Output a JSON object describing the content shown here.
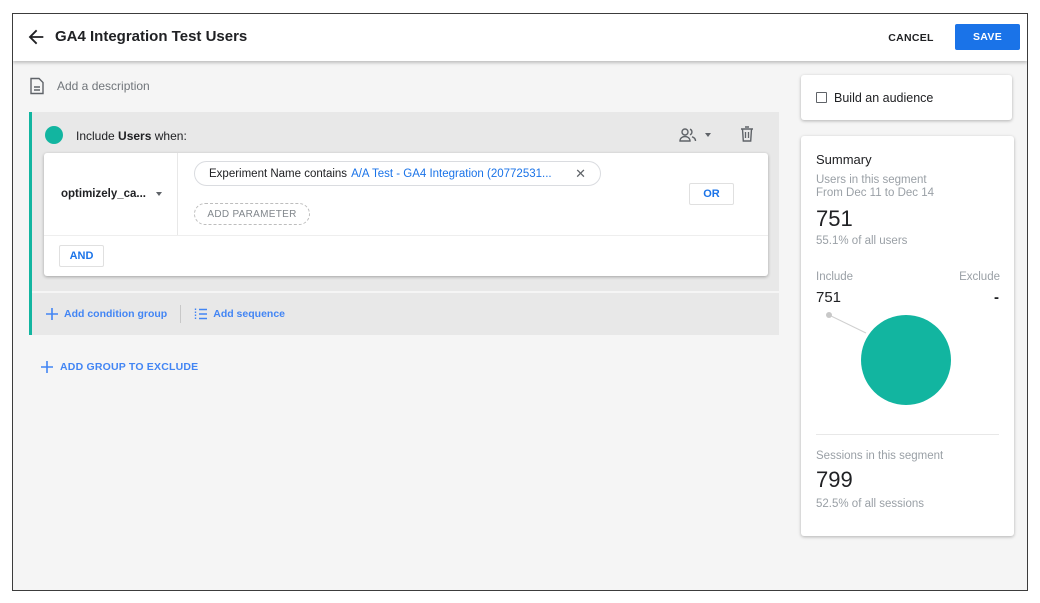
{
  "header": {
    "title": "GA4 Integration Test Users",
    "cancel_label": "CANCEL",
    "save_label": "SAVE",
    "back_icon": "arrow-left-icon"
  },
  "description": {
    "placeholder": "Add a description",
    "icon": "document-icon"
  },
  "include_group": {
    "prefix": "Include",
    "scope": "Users",
    "suffix": "when:",
    "accent_color": "#12b5a0",
    "condition": {
      "dimension": "optimizely_ca...",
      "filter_label": "Experiment Name contains",
      "filter_value": "A/A Test - GA4 Integration (20772531...",
      "add_parameter_label": "ADD PARAMETER",
      "or_label": "OR",
      "and_label": "AND"
    },
    "add_condition_group_label": "Add condition group",
    "add_sequence_label": "Add sequence"
  },
  "add_exclude_label": "ADD GROUP TO EXCLUDE",
  "audience": {
    "label": "Build an audience",
    "checked": false
  },
  "summary": {
    "title": "Summary",
    "users_label": "Users in this segment",
    "date_range": "From Dec 11 to Dec 14",
    "users_value": "751",
    "users_pct": "55.1% of all users",
    "include_label": "Include",
    "exclude_label": "Exclude",
    "include_value": "751",
    "exclude_value": "-",
    "sessions_label": "Sessions in this segment",
    "sessions_value": "799",
    "sessions_pct": "52.5% of all sessions",
    "pie_color": "#12b5a0"
  },
  "colors": {
    "primary": "#1a73e8",
    "link": "#4285f4",
    "accent": "#12b5a0"
  }
}
